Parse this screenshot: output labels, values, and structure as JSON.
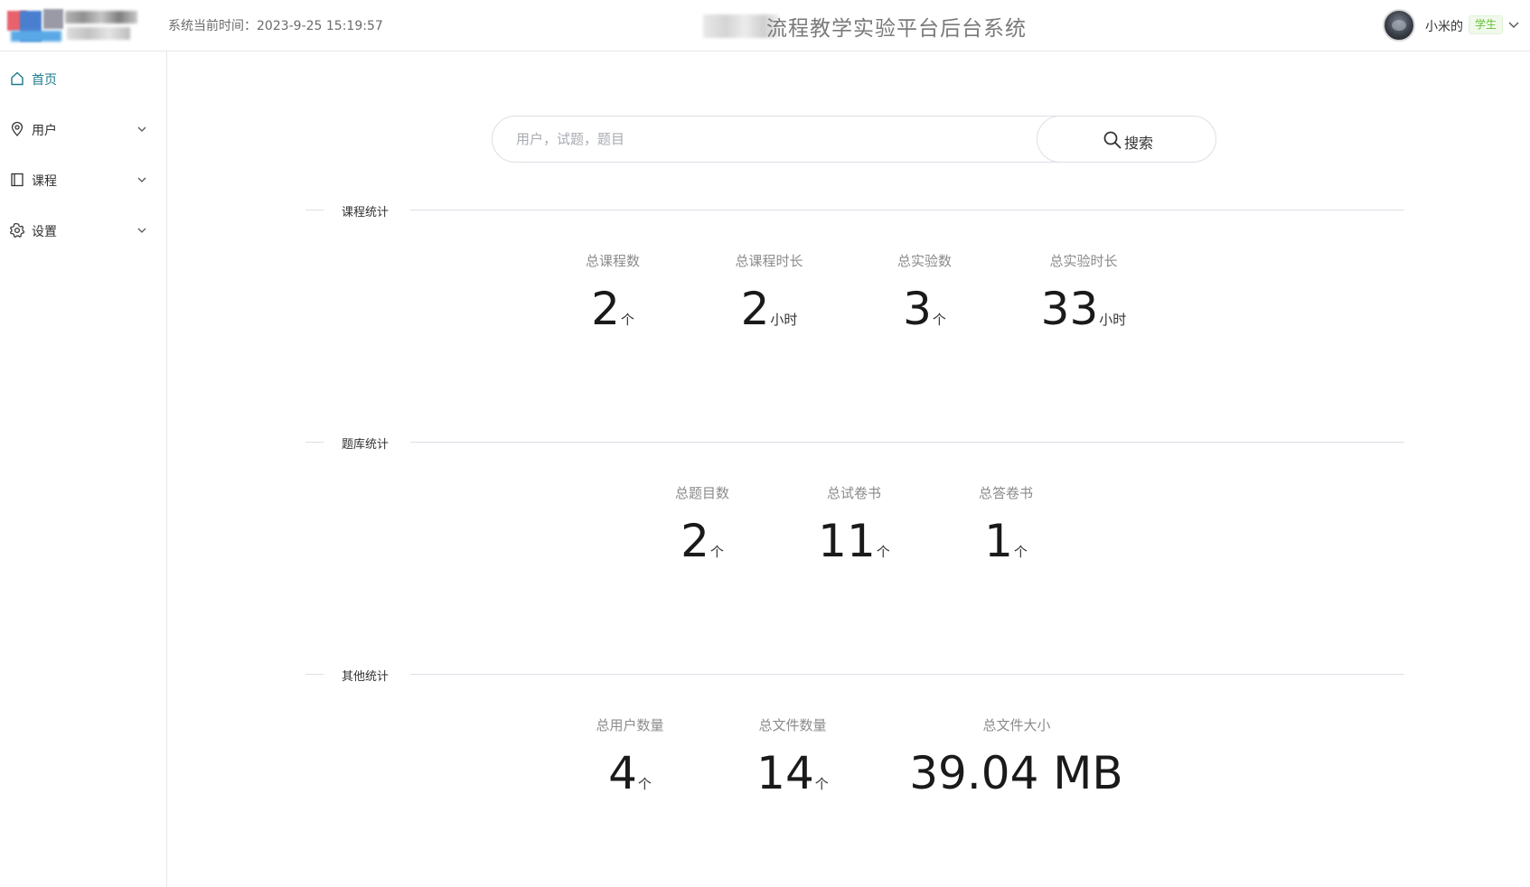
{
  "header": {
    "clock_label": "系统当前时间：2023-9-25 15:19:57",
    "app_title": "流程教学实验平台后台系统",
    "user": {
      "name": "小米的",
      "role": "学生"
    }
  },
  "sidebar": {
    "items": [
      {
        "label": "首页",
        "icon": "home-icon"
      },
      {
        "label": "用户",
        "icon": "location-pin-icon"
      },
      {
        "label": "课程",
        "icon": "notebook-icon"
      },
      {
        "label": "设置",
        "icon": "gear-icon"
      }
    ]
  },
  "search": {
    "placeholder": "用户，试题，题目",
    "button_label": "搜索"
  },
  "sections": [
    {
      "title": "课程统计",
      "stats": [
        {
          "label": "总课程数",
          "value": "2",
          "unit": "个"
        },
        {
          "label": "总课程时长",
          "value": "2",
          "unit": "小时"
        },
        {
          "label": "总实验数",
          "value": "3",
          "unit": "个"
        },
        {
          "label": "总实验时长",
          "value": "33",
          "unit": "小时"
        }
      ]
    },
    {
      "title": "题库统计",
      "stats": [
        {
          "label": "总题目数",
          "value": "2",
          "unit": "个"
        },
        {
          "label": "总试卷书",
          "value": "11",
          "unit": "个"
        },
        {
          "label": "总答卷书",
          "value": "1",
          "unit": "个"
        }
      ]
    },
    {
      "title": "其他统计",
      "stats": [
        {
          "label": "总用户数量",
          "value": "4",
          "unit": "个"
        },
        {
          "label": "总文件数量",
          "value": "14",
          "unit": "个"
        },
        {
          "label": "总文件大小",
          "value": "39.04 MB",
          "unit": ""
        }
      ]
    }
  ],
  "colors": {
    "accent": "#1b7a8c",
    "role_badge_text": "#67c23a",
    "role_badge_bg": "#f0f9eb"
  }
}
